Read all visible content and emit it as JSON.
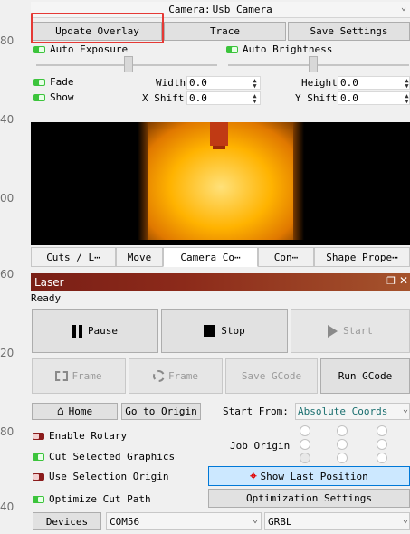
{
  "ruler": [
    "80",
    "40",
    "00",
    "60",
    "20",
    "80",
    "40"
  ],
  "camera": {
    "selector_label": "Camera:",
    "selector_value": "Usb Camera",
    "update_overlay": "Update Overlay",
    "trace": "Trace",
    "save_settings": "Save Settings",
    "auto_exposure": "Auto Exposure",
    "auto_brightness": "Auto Brightness",
    "fade": "Fade",
    "show": "Show",
    "width_label": "Width",
    "width_value": "0.0",
    "height_label": "Height",
    "height_value": "0.0",
    "xshift_label": "X Shift",
    "xshift_value": "0.0",
    "yshift_label": "Y Shift",
    "yshift_value": "0.0"
  },
  "tabs": [
    "Cuts / L⋯",
    "Move",
    "Camera Co⋯",
    "Con⋯",
    "Shape Prope⋯"
  ],
  "laser": {
    "title": "Laser",
    "status": "Ready",
    "pause": "Pause",
    "stop": "Stop",
    "start": "Start",
    "frame1": "Frame",
    "frame2": "Frame",
    "save_gcode": "Save GCode",
    "run_gcode": "Run GCode",
    "home": "Home",
    "go_to_origin": "Go to Origin",
    "start_from_label": "Start From:",
    "start_from_value": "Absolute Coords",
    "enable_rotary": "Enable Rotary",
    "cut_selected": "Cut Selected Graphics",
    "use_selection_origin": "Use Selection Origin",
    "optimize_cut_path": "Optimize Cut Path",
    "job_origin": "Job Origin",
    "show_last_position": "Show Last Position",
    "optimization_settings": "Optimization Settings",
    "devices": "Devices",
    "port": "COM56",
    "firmware": "GRBL"
  },
  "colors": {
    "highlight_box": "#e53935",
    "titlebar": "#7a1f16",
    "accent_blue": "#cce8ff",
    "link_teal": "#1a6f6f",
    "toggle_on": "#3cc43c",
    "toggle_off": "#8b1c1c"
  }
}
